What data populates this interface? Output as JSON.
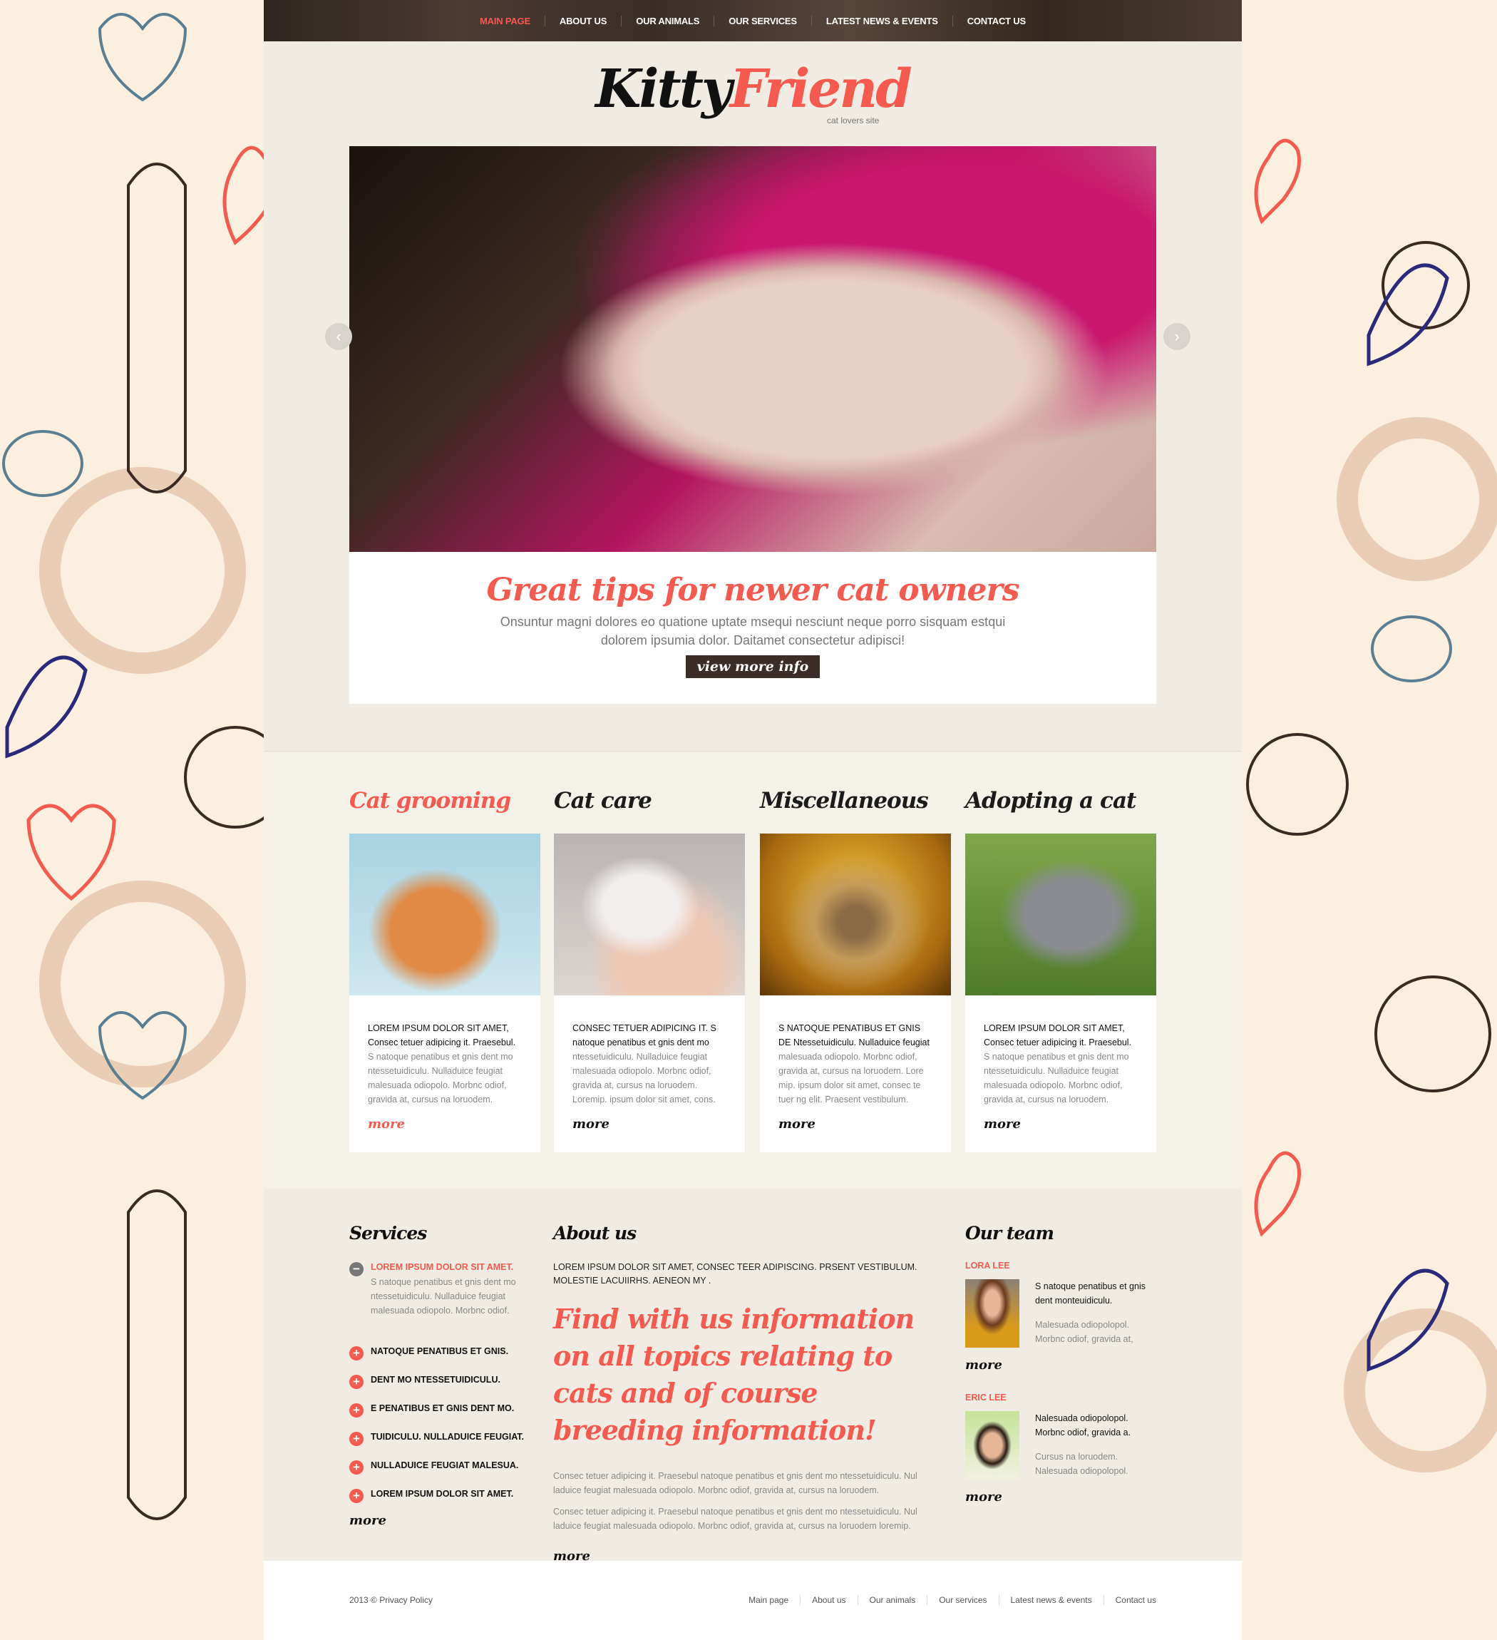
{
  "colors": {
    "accent": "#f5594f",
    "dark": "#3b2d27",
    "content_bg": "#f0ece3",
    "page_bg": "#fbefe0"
  },
  "nav": [
    {
      "label": "MAIN PAGE",
      "active": true
    },
    {
      "label": "ABOUT US"
    },
    {
      "label": "OUR ANIMALS"
    },
    {
      "label": "OUR SERVICES"
    },
    {
      "label": "LATEST NEWS & EVENTS"
    },
    {
      "label": "CONTACT US"
    }
  ],
  "logo": {
    "part1": "Kitty",
    "part2": "Friend",
    "tagline": "cat lovers site"
  },
  "slider": {
    "title": "Great tips for newer cat owners",
    "text": "Onsuntur magni dolores eo quatione uptate msequi nesciunt neque porro sisquam estqui dolorem ipsumia dolor. Daitamet consectetur adipisci!",
    "button": "view more info",
    "prev_icon": "chevron-left-icon",
    "next_icon": "chevron-right-icon"
  },
  "categories": [
    {
      "title": "Cat grooming",
      "lead": "LOREM IPSUM DOLOR SIT AMET, Consec tetuer adipicing it. Praesebul.",
      "text": "S natoque penatibus et gnis dent mo ntessetuidiculu. Nulladuice feugiat malesuada odiopolo. Morbnc odiof, gravida at, cursus na loruodem.",
      "more": "more"
    },
    {
      "title": "Cat care",
      "lead": "CONSEC TETUER ADIPICING IT. S natoque penatibus et gnis dent mo",
      "text": "ntessetuidiculu. Nulladuice feugiat malesuada odiopolo. Morbnc odiof, gravida at, cursus na loruodem. Loremip. ipsum dolor sit amet, cons.",
      "more": "more"
    },
    {
      "title": "Miscellaneous",
      "lead": "S NATOQUE PENATIBUS ET GNIS DE Ntessetuidiculu. Nulladuice feugiat",
      "text": "malesuada odiopolo. Morbnc odiof, gravida at, cursus na loruodem. Lore mip. ipsum dolor sit amet, consec te tuer ng elit. Praesent vestibulum.",
      "more": "more"
    },
    {
      "title": "Adopting a cat",
      "lead": "LOREM IPSUM DOLOR SIT AMET, Consec tetuer adipicing it. Praesebul.",
      "text": "S natoque penatibus et gnis dent mo ntessetuidiculu. Nulladuice feugiat malesuada odiopolo. Morbnc odiof, gravida at, cursus na loruodem.",
      "more": "more"
    }
  ],
  "services": {
    "title": "Services",
    "open": {
      "label": "LOREM IPSUM DOLOR SIT AMET.",
      "desc": "S natoque penatibus et gnis dent mo ntessetuidiculu. Nulladuice feugiat malesuada odiopolo. Morbnc odiof."
    },
    "items": [
      "NATOQUE PENATIBUS ET GNIS.",
      "DENT MO NTESSETUIDICULU.",
      "E PENATIBUS ET GNIS DENT MO.",
      "TUIDICULU. NULLADUICE FEUGIAT.",
      "NULLADUICE FEUGIAT MALESUA.",
      "LOREM IPSUM DOLOR SIT AMET."
    ],
    "more": "more"
  },
  "about": {
    "title": "About us",
    "intro": "LOREM IPSUM DOLOR SIT AMET, CONSEC TEER ADIPISCING. PRSENT VESTIBULUM. MOLESTIE LACUIIRHS. AENEON MY .",
    "highlight": "Find with us information on all topics relating to cats and of course breeding information!",
    "p1": "Consec tetuer adipicing it. Praesebul natoque penatibus et gnis dent mo ntessetuidiculu. Nul laduice feugiat  malesuada odiopolo. Morbnc odiof,  gravida at, cursus na loruodem.",
    "p2": "Consec tetuer adipicing it. Praesebul natoque penatibus et gnis dent mo ntessetuidiculu. Nul laduice feugiat  malesuada odiopolo. Morbnc odiof,  gravida at, cursus na loruodem loremip.",
    "more": "more"
  },
  "team": {
    "title": "Our team",
    "members": [
      {
        "name": "LORA LEE",
        "a": "S natoque penatibus et gnis dent monteuidiculu.",
        "b": "Malesuada odiopolopol. Morbnc odiof,  gravida at,",
        "more": "more"
      },
      {
        "name": "ERIC LEE",
        "a": "Nalesuada odiopolopol. Morbnc odiof,  gravida a.",
        "b": "Cursus na loruodem. Nalesuada odiopolopol.",
        "more": "more"
      }
    ]
  },
  "footer": {
    "copy": "2013 © Privacy Policy",
    "links": [
      "Main page",
      "About us",
      "Our animals",
      "Our services",
      "Latest news & events",
      "Contact us"
    ]
  }
}
